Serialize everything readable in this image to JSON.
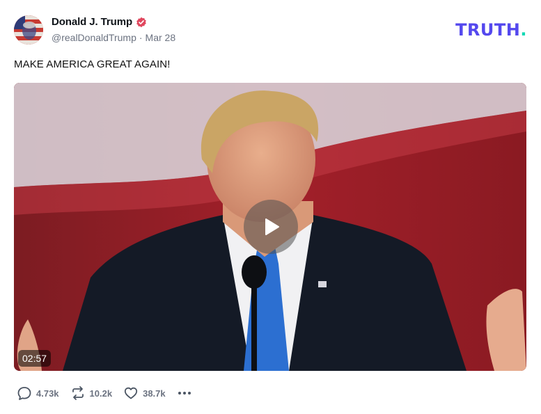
{
  "author": {
    "display_name": "Donald J. Trump",
    "handle": "@realDonaldTrump",
    "separator": "·",
    "date": "Mar 28",
    "verified": true
  },
  "brand": {
    "logo_text": "TRUTH",
    "logo_dot": ".",
    "primary_color": "#5448ee",
    "accent_color": "#0ed8b4"
  },
  "post": {
    "text": "MAKE AMERICA GREAT AGAIN!"
  },
  "media": {
    "type": "video",
    "duration": "02:57",
    "play_icon": "play-icon"
  },
  "actions": {
    "replies": "4.73k",
    "retruths": "10.2k",
    "likes": "38.7k",
    "more_icon": "more-dots-icon"
  }
}
